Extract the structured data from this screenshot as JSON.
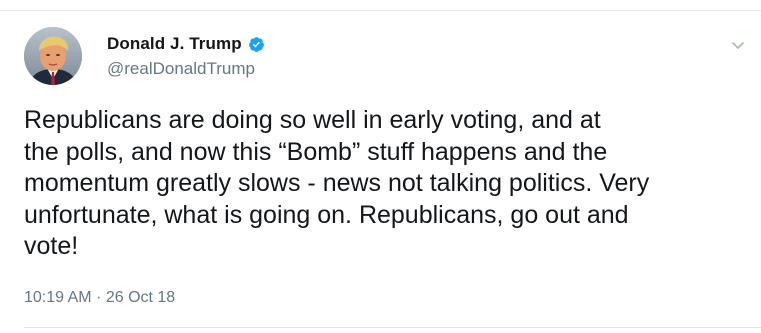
{
  "tweet": {
    "display_name": "Donald J. Trump",
    "handle": "@realDonaldTrump",
    "verified": true,
    "text": "Republicans are doing so well in early voting, and at\nthe polls, and now this “Bomb” stuff happens and the\nmomentum greatly slows - news not talking politics. Very\nunfortunate, what is going on. Republicans, go out and\nvote!",
    "timestamp": "10:19 AM · 26 Oct 18"
  },
  "icons": {
    "avatar": "profile-photo",
    "verified": "verified-badge-icon",
    "menu": "chevron-down-icon"
  },
  "colors": {
    "text_primary": "#14171a",
    "text_secondary": "#657786",
    "verified_blue": "#1da1f2",
    "divider": "#e1e8ed"
  }
}
